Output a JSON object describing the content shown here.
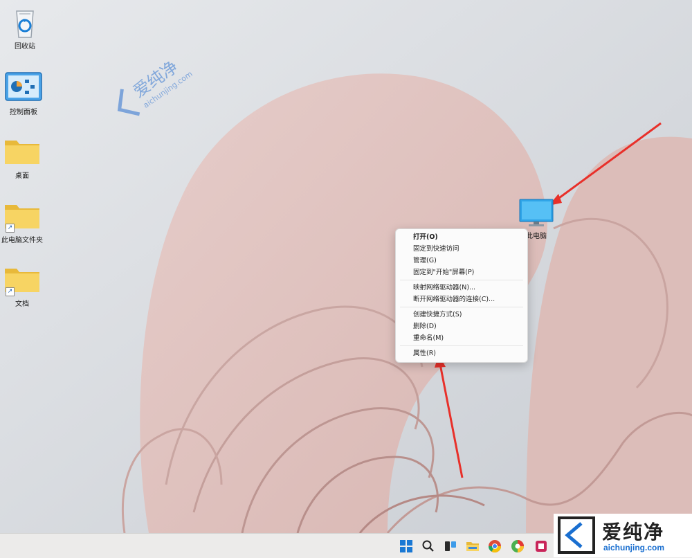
{
  "desktop": {
    "icons": [
      {
        "label": "回收站",
        "icon": "recycle-bin-icon"
      },
      {
        "label": "控制面板",
        "icon": "control-panel-icon"
      },
      {
        "label": "桌面",
        "icon": "folder-icon"
      },
      {
        "label": "此电脑文件夹",
        "icon": "folder-shortcut-icon"
      },
      {
        "label": "文档",
        "icon": "folder-shortcut-icon"
      },
      {
        "label": "此电脑",
        "icon": "monitor-icon"
      }
    ]
  },
  "context_menu": {
    "items": [
      {
        "label": "打开(O)"
      },
      {
        "label": "固定到快速访问"
      },
      {
        "label": "管理(G)"
      },
      {
        "label": "固定到\"开始\"屏幕(P)"
      },
      {
        "label": "映射网络驱动器(N)..."
      },
      {
        "label": "断开网络驱动器的连接(C)..."
      },
      {
        "label": "创建快捷方式(S)"
      },
      {
        "label": "删除(D)"
      },
      {
        "label": "重命名(M)"
      },
      {
        "label": "属性(R)"
      }
    ]
  },
  "watermark": {
    "cn": "爱纯净",
    "url": "aichunjing.com"
  },
  "taskbar": {
    "icons": [
      "start-icon",
      "search-icon",
      "task-view-icon",
      "file-explorer-icon",
      "chrome-icon",
      "browser-icon",
      "app-icon"
    ]
  },
  "colors": {
    "annotation_arrow": "#e8302a",
    "accent": "#1a6fd0"
  }
}
